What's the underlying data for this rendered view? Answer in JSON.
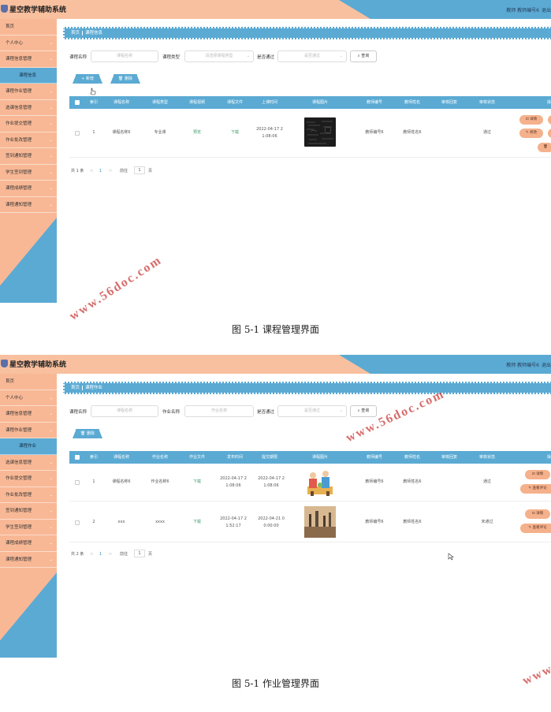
{
  "app": {
    "system_title": "星空教学辅助系统",
    "user_info": "教师 教师编号6",
    "logout": "退出登录"
  },
  "colors": {
    "accent_blue": "#5aaad4",
    "accent_peach": "#f9b895",
    "button_peach": "#f4b18c"
  },
  "watermark": "www.56doc.com",
  "screen1": {
    "sidebar": [
      {
        "label": "首页",
        "chevron": false
      },
      {
        "label": "个人中心",
        "chevron": true
      },
      {
        "label": "课程信息管理",
        "chevron": true
      },
      {
        "label": "课程信息",
        "chevron": false,
        "active": true
      },
      {
        "label": "课程作业管理",
        "chevron": true
      },
      {
        "label": "选课信息管理",
        "chevron": true
      },
      {
        "label": "作业提交管理",
        "chevron": true
      },
      {
        "label": "作业批改管理",
        "chevron": true
      },
      {
        "label": "签到通知管理",
        "chevron": true
      },
      {
        "label": "学生签到管理",
        "chevron": true
      },
      {
        "label": "课程成绩管理",
        "chevron": true
      },
      {
        "label": "课程通知管理",
        "chevron": true
      }
    ],
    "breadcrumb": {
      "home": "首页",
      "current": "课程信息"
    },
    "search": {
      "label1": "课程名称",
      "placeholder1": "课程名称",
      "label2": "课程类型",
      "placeholder2": "请选择课程类型",
      "label3": "是否通过",
      "placeholder3": "是否通过",
      "query": "查询"
    },
    "buttons": {
      "add": "新增",
      "delete": "删除"
    },
    "headers": [
      "索引",
      "课程名称",
      "课程类型",
      "课程视频",
      "课程文件",
      "上课时间",
      "课程图片",
      "教师编号",
      "教师姓名",
      "审核回复",
      "审核状态",
      "操作"
    ],
    "rows": [
      {
        "index": "1",
        "name": "课程名称6",
        "type": "专业课",
        "video": "预览",
        "file": "下载",
        "time1": "2022-04-17 2",
        "time2": "1:08:06",
        "teacher_no": "教师编号6",
        "teacher_name": "教师姓名6",
        "reply": "",
        "status": "通过"
      }
    ],
    "ops": {
      "detail": "详情",
      "edit": "修改"
    },
    "pager": {
      "total": "共 1 条",
      "prev": "<",
      "page": "1",
      "next": ">",
      "goto": "前往",
      "page_no": "1",
      "page_unit": "页"
    },
    "caption": "图 5-1  课程管理界面"
  },
  "screen2": {
    "sidebar": [
      {
        "label": "首页",
        "chevron": false
      },
      {
        "label": "个人中心",
        "chevron": true
      },
      {
        "label": "课程信息管理",
        "chevron": true
      },
      {
        "label": "课程作业管理",
        "chevron": true
      },
      {
        "label": "课程作业",
        "chevron": false,
        "active": true
      },
      {
        "label": "选课信息管理",
        "chevron": true
      },
      {
        "label": "作业提交管理",
        "chevron": true
      },
      {
        "label": "作业批改管理",
        "chevron": true
      },
      {
        "label": "签到通知管理",
        "chevron": true
      },
      {
        "label": "学生签到管理",
        "chevron": true
      },
      {
        "label": "课程成绩管理",
        "chevron": true
      },
      {
        "label": "课程通知管理",
        "chevron": true
      }
    ],
    "breadcrumb": {
      "home": "首页",
      "current": "课程作业"
    },
    "search": {
      "label1": "课程名称",
      "placeholder1": "课程名称",
      "label2": "作业名称",
      "placeholder2": "作业名称",
      "label3": "是否通过",
      "placeholder3": "是否通过",
      "query": "查询"
    },
    "buttons": {
      "delete": "删除"
    },
    "headers": [
      "索引",
      "课程名称",
      "作业名称",
      "作业文件",
      "发布时间",
      "提交期限",
      "课程图片",
      "教师编号",
      "教师姓名",
      "审核回复",
      "审核状态",
      "操作"
    ],
    "rows": [
      {
        "index": "1",
        "name": "课程名称6",
        "hw": "作业名称6",
        "file": "下载",
        "pub1": "2022-04-17 2",
        "pub2": "1:08:06",
        "due1": "2022-04-17 2",
        "due2": "1:08:06",
        "teacher_no": "教师编号6",
        "teacher_name": "教师姓名6",
        "reply": "",
        "status": "通过"
      },
      {
        "index": "2",
        "name": "xxx",
        "hw": "xxxx",
        "file": "下载",
        "pub1": "2022-04-17 2",
        "pub2": "1:52:17",
        "due1": "2022-04-21 0",
        "due2": "0:00:00",
        "teacher_no": "教师编号6",
        "teacher_name": "教师姓名6",
        "reply": "",
        "status": "未通过"
      }
    ],
    "ops": {
      "detail": "详情",
      "comments": "查看评论"
    },
    "pager": {
      "total": "共 2 条",
      "prev": "<",
      "page": "1",
      "next": ">",
      "goto": "前往",
      "page_no": "1",
      "page_unit": "页"
    },
    "caption": "图 5-1  作业管理界面"
  }
}
